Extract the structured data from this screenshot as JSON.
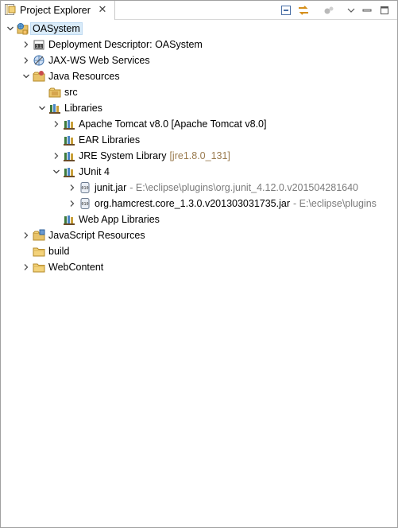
{
  "view": {
    "tab_title": "Project Explorer",
    "tab_close": "✕"
  },
  "toolbar": {
    "collapse_all": "collapse-all-icon",
    "link_editor": "link-with-editor-icon",
    "focus": "focus-icon",
    "view_menu": "view-menu-icon",
    "minimize": "minimize-icon",
    "maximize": "maximize-icon"
  },
  "tree": {
    "project": "OASystem",
    "deployment_descriptor": "Deployment Descriptor: OASystem",
    "jaxws": "JAX-WS Web Services",
    "java_resources": "Java Resources",
    "src": "src",
    "libraries": "Libraries",
    "tomcat": "Apache Tomcat v8.0 [Apache Tomcat v8.0]",
    "ear": "EAR Libraries",
    "jre": "JRE System Library",
    "jre_deco": "[jre1.8.0_131]",
    "junit": "JUnit 4",
    "junit_jar": "junit.jar",
    "junit_jar_deco": "- E:\\eclipse\\plugins\\org.junit_4.12.0.v201504281640",
    "hamcrest_jar": "org.hamcrest.core_1.3.0.v201303031735.jar",
    "hamcrest_jar_deco": "- E:\\eclipse\\plugins",
    "webapp_libs": "Web App Libraries",
    "js_resources": "JavaScript Resources",
    "build": "build",
    "webcontent": "WebContent"
  },
  "colors": {
    "selection": "#d9ebf9",
    "decoration_brown": "#9a7b4f",
    "decoration_gray": "#7b7b7b",
    "folder": "#e8c36a"
  }
}
